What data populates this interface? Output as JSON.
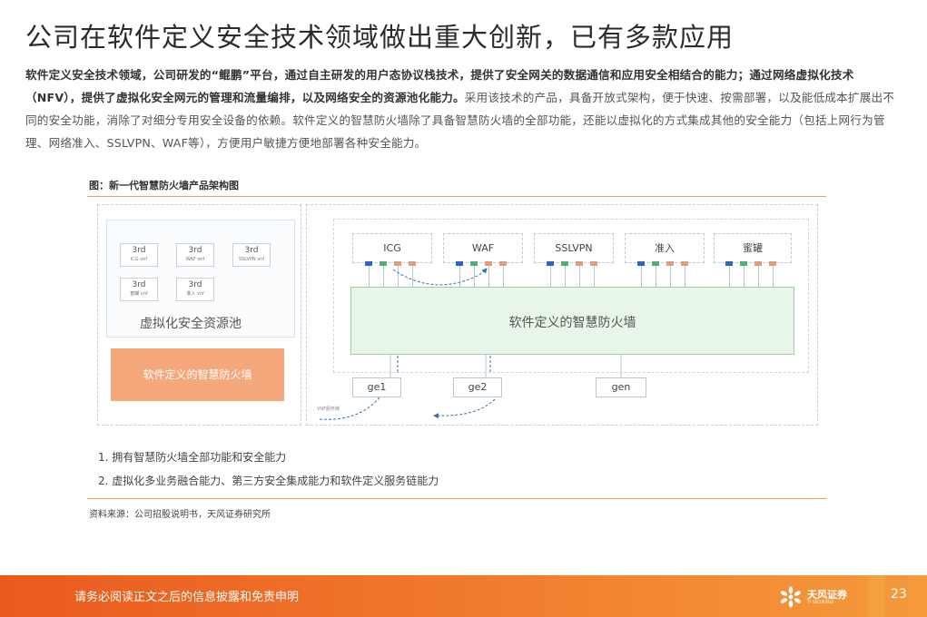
{
  "page": {
    "title": "公司在软件定义安全技术领域做出重大创新，已有多款应用",
    "paragraph": {
      "bold_1": "软件定义安全技术领域，公司研发的“鲲鹏”平台，通过自主研发的用户态协议栈技术，提供了安全网关的数据通信和应用安全相结合的能力；通过网络虚拟化技术（NFV），提供了虚拟化安全网元的管理和流量编排，以及网络安全的资源池化能力。",
      "normal_1": "采用该技术的产品，具备开放式架构，便于快速、按需部署，以及能低成本扩展出不同的安全功能，消除了对细分专用安全设备的依赖。软件定义的智慧防火墙除了具备智慧防火墙的全部功能，还能以虚拟化的方式集成其他的安全能力（包括上网行为管理、网络准入、SSLVPN、WAF等），方便用户敏捷方便地部署各种安全能力。"
    }
  },
  "figure": {
    "caption": "图：新一代智慧防火墙产品架构图",
    "vnf_cards": [
      {
        "line1": "3rd",
        "line2": "ICG vnf"
      },
      {
        "line1": "3rd",
        "line2": "WAF vnf"
      },
      {
        "line1": "3rd",
        "line2": "SSLVPN vnf"
      },
      {
        "line1": "3rd",
        "line2": "蜜罐 vnf"
      },
      {
        "line1": "3rd",
        "line2": "准入 vnf"
      }
    ],
    "pool_label": "虚拟化安全资源池",
    "left_fw_label": "软件定义的智慧防火墙",
    "modules": [
      "ICG",
      "WAF",
      "SSLVPN",
      "准入",
      "蜜罐"
    ],
    "main_label": "软件定义的智慧防火墙",
    "ports": [
      "ge1",
      "ge2",
      "gen"
    ],
    "chain_note": "VNF服务链",
    "port_colors": [
      "#2e66b8",
      "#4caf73",
      "#e39c7a",
      "#e39c7a"
    ],
    "features": [
      "1. 拥有智慧防火墙全部功能和安全能力",
      "2. 虚拟化多业务融合能力、第三方安全集成能力和软件定义服务链能力"
    ],
    "source": "资料来源：公司招股说明书，天风证券研究所"
  },
  "footer": {
    "disclaimer": "请务必阅读正文之后的信息披露和免责申明",
    "brand": "天风证券",
    "brand_sub": "TF SECURITIES",
    "page_number": "23"
  }
}
